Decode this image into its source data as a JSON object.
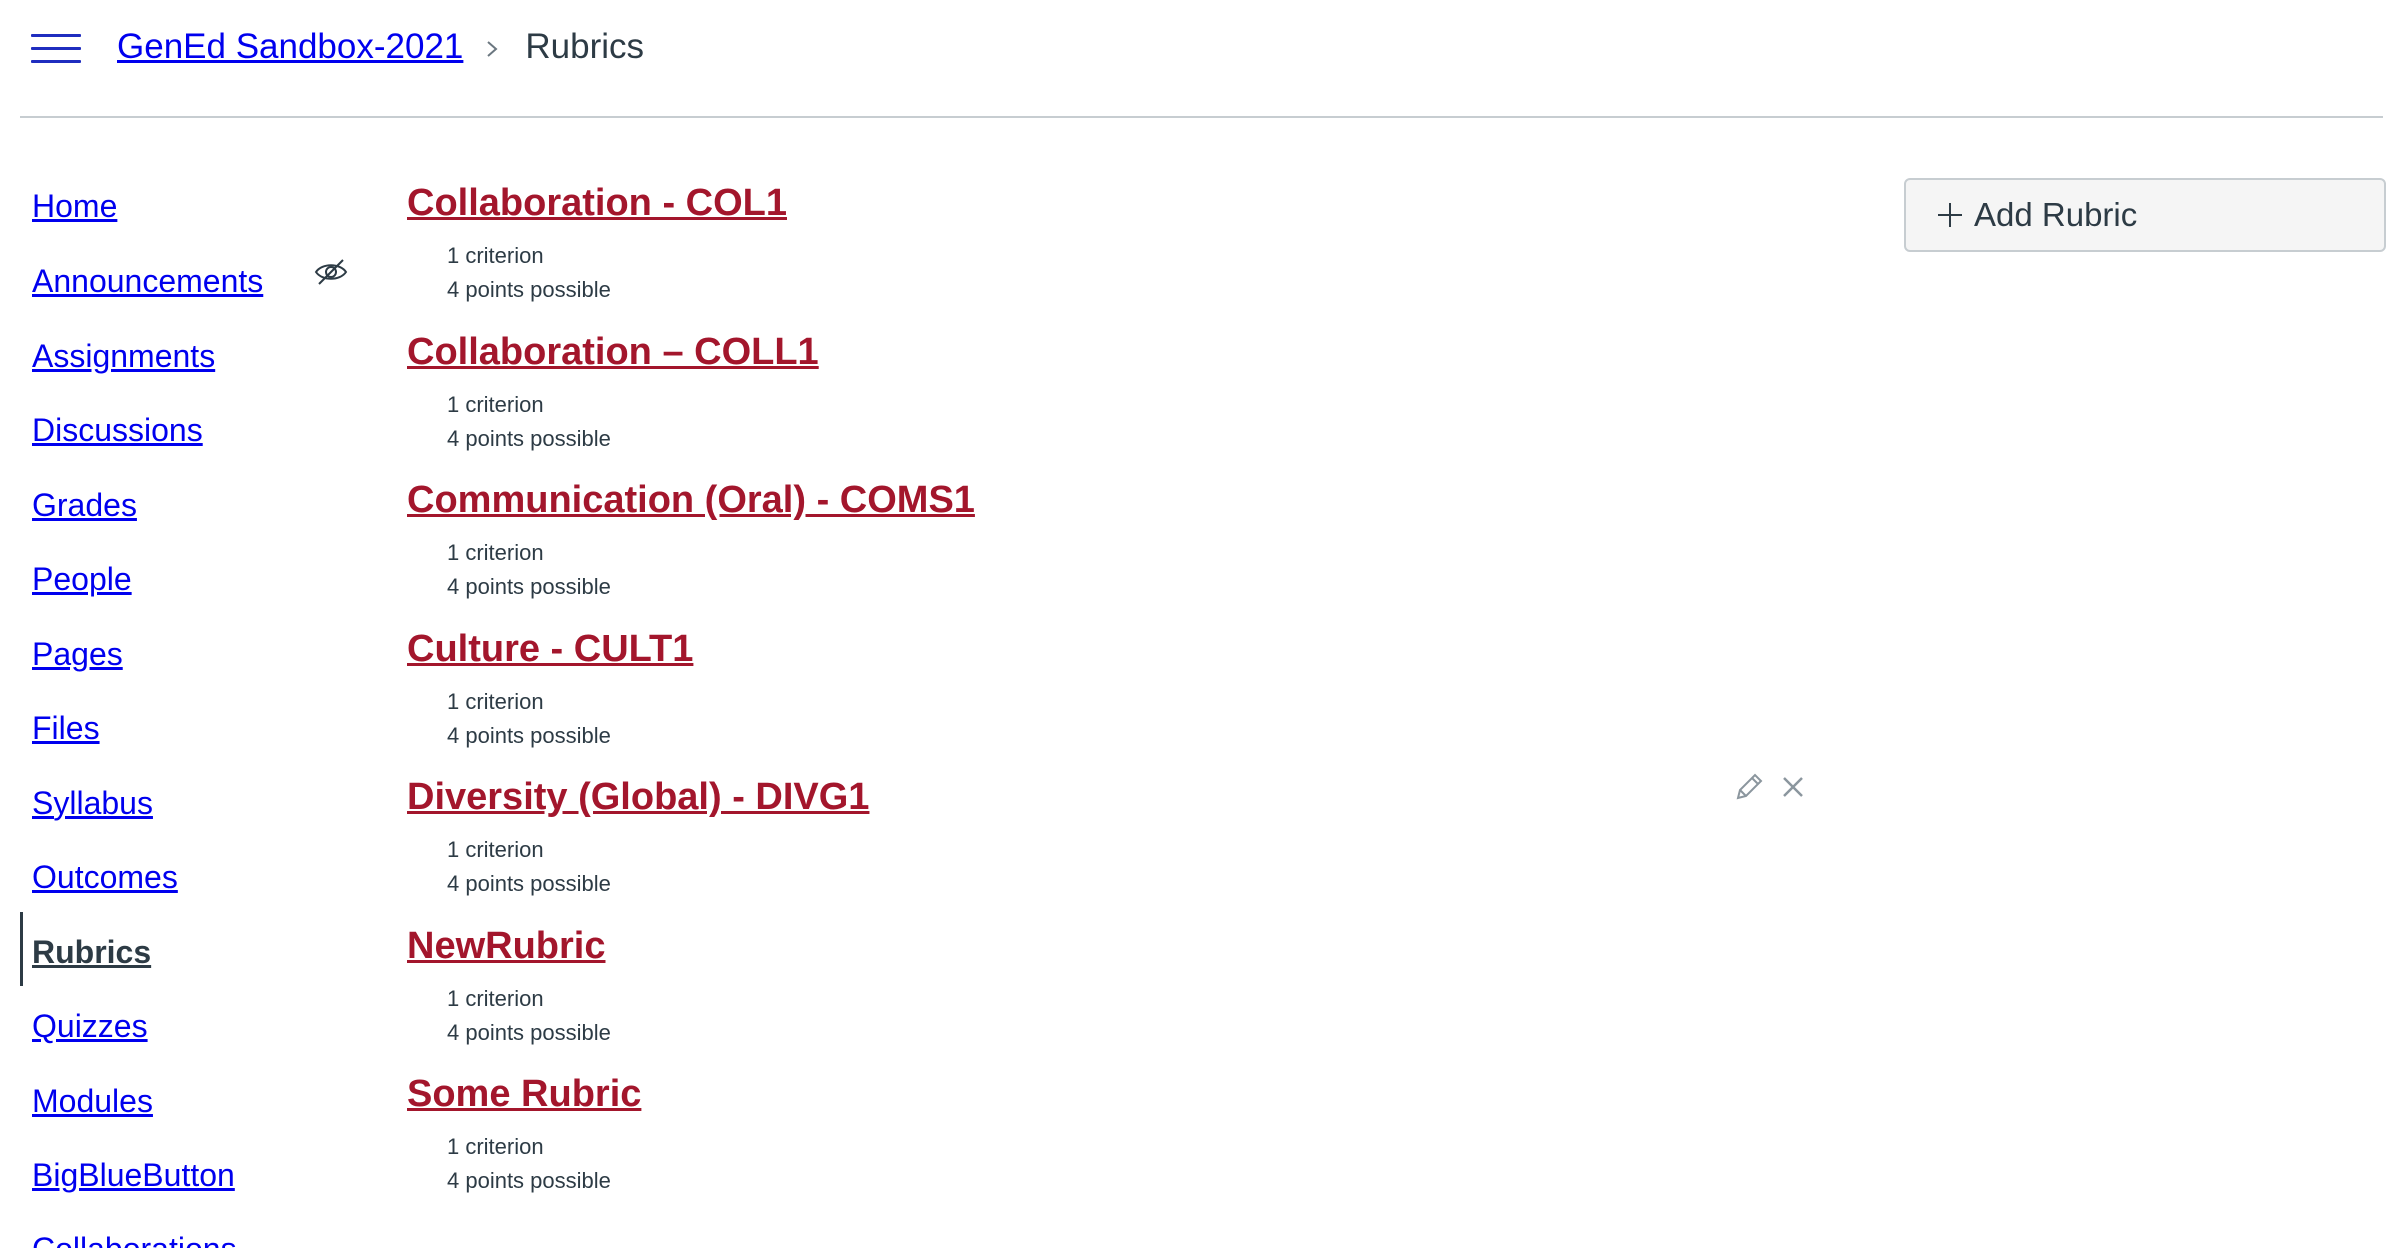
{
  "header": {
    "breadcrumb": {
      "course": "GenEd Sandbox-2021",
      "current": "Rubrics"
    }
  },
  "sidebar": {
    "items": [
      {
        "label": "Home"
      },
      {
        "label": "Announcements",
        "icon": "eye-slash-icon"
      },
      {
        "label": "Assignments"
      },
      {
        "label": "Discussions"
      },
      {
        "label": "Grades"
      },
      {
        "label": "People"
      },
      {
        "label": "Pages"
      },
      {
        "label": "Files"
      },
      {
        "label": "Syllabus"
      },
      {
        "label": "Outcomes"
      },
      {
        "label": "Rubrics",
        "active": true
      },
      {
        "label": "Quizzes"
      },
      {
        "label": "Modules"
      },
      {
        "label": "BigBlueButton"
      },
      {
        "label": "Collaborations"
      }
    ]
  },
  "rubrics": [
    {
      "title": "Collaboration - COL1",
      "criteria": "1 criterion",
      "points": "4 points possible"
    },
    {
      "title": "Collaboration – COLL1",
      "criteria": "1 criterion",
      "points": "4 points possible"
    },
    {
      "title": "Communication (Oral) - COMS1",
      "criteria": "1 criterion",
      "points": "4 points possible"
    },
    {
      "title": "Culture - CULT1",
      "criteria": "1 criterion",
      "points": "4 points possible"
    },
    {
      "title": "Diversity (Global) - DIVG1",
      "criteria": "1 criterion",
      "points": "4 points possible"
    },
    {
      "title": "NewRubric",
      "criteria": "1 criterion",
      "points": "4 points possible"
    },
    {
      "title": "Some Rubric",
      "criteria": "1 criterion",
      "points": "4 points possible"
    }
  ],
  "actions": {
    "add_rubric_label": "Add Rubric"
  },
  "colors": {
    "link": "#0000ee",
    "rubric_title": "#a3162c",
    "text": "#2d3b45",
    "divider": "#c7cdd1"
  }
}
